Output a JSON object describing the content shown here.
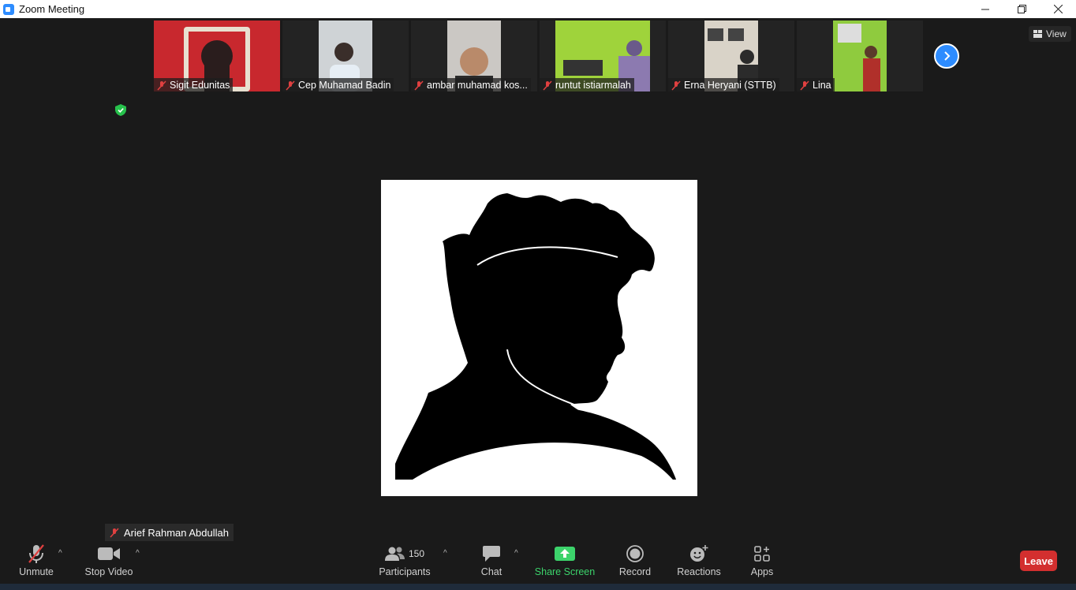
{
  "window": {
    "title": "Zoom Meeting"
  },
  "gallery": [
    {
      "name": "Sigit Edunitas",
      "bg": "#c8282e"
    },
    {
      "name": "Cep Muhamad Badin",
      "bg": "#cfd3d6"
    },
    {
      "name": "ambar muhamad kos...",
      "bg": "#cbc8c4"
    },
    {
      "name": "runtut istiarmalah",
      "bg": "#9fd33b"
    },
    {
      "name": "Erna Heryani (STTB)",
      "bg": "#d9d3c8"
    },
    {
      "name": "Lina",
      "bg": "#8fcb3e"
    }
  ],
  "view_label": "View",
  "active_speaker": "Arief Rahman Abdullah",
  "toolbar": {
    "unmute": "Unmute",
    "stop_video": "Stop Video",
    "participants": "Participants",
    "participants_count": "150",
    "chat": "Chat",
    "share_screen": "Share Screen",
    "record": "Record",
    "reactions": "Reactions",
    "apps": "Apps",
    "leave": "Leave"
  },
  "colors": {
    "accent": "#2d8cff",
    "share": "#3cd36b",
    "leave": "#d32f2f",
    "background": "#1a1a1a"
  }
}
